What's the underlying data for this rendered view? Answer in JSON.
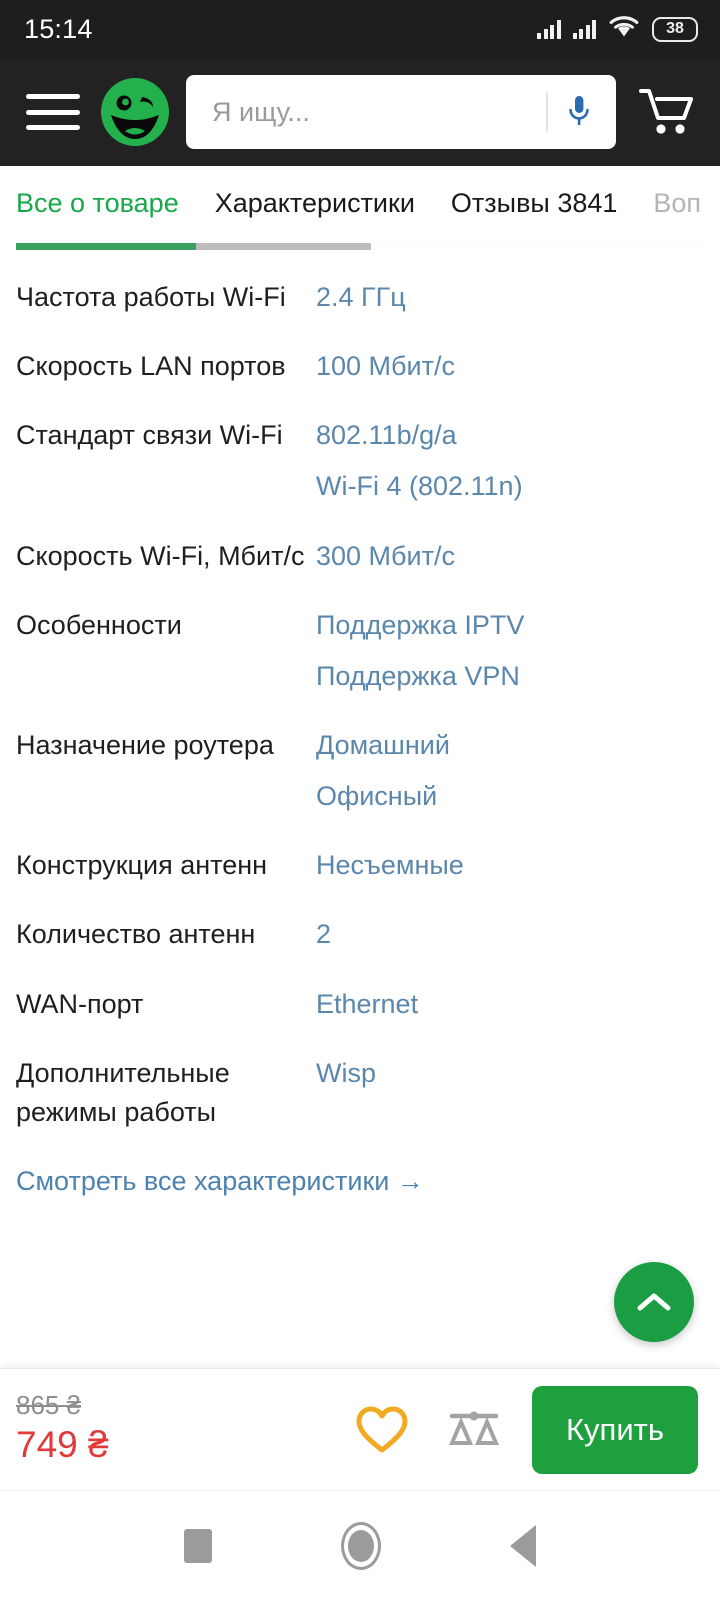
{
  "status_bar": {
    "clock": "15:14",
    "battery_level": "38",
    "icons": [
      "signal-bars-icon",
      "signal-bars-icon",
      "wifi-icon",
      "battery-icon"
    ]
  },
  "header": {
    "menu_icon": "hamburger-menu-icon",
    "logo_icon": "rozetka-smiley-logo",
    "search_placeholder": "Я ищу...",
    "search_value": "",
    "mic_icon": "microphone-icon",
    "cart_icon": "shopping-cart-icon",
    "background_color": "#222222"
  },
  "tabs": {
    "items": [
      {
        "label": "Все о товаре",
        "state": "active"
      },
      {
        "label": "Характеристики",
        "state": "normal"
      },
      {
        "label": "Отзывы 3841",
        "state": "normal"
      },
      {
        "label": "Воп",
        "state": "faded"
      }
    ],
    "active_color": "#17a84a",
    "scroll_indicator": {
      "green_width": 180,
      "gray_width": 355
    }
  },
  "specs": {
    "rows": [
      {
        "label": "Частота работы Wi-Fi",
        "values": [
          "2.4 ГГц"
        ]
      },
      {
        "label": "Скорость LAN портов",
        "values": [
          "100 Мбит/с"
        ]
      },
      {
        "label": "Стандарт связи Wi-Fi",
        "values": [
          "802.11b/g/a",
          "Wi-Fi 4 (802.11n)"
        ]
      },
      {
        "label": "Скорость Wi-Fi, Мбит/с",
        "values": [
          "300 Мбит/с"
        ]
      },
      {
        "label": "Особенности",
        "values": [
          "Поддержка IPTV",
          "Поддержка VPN"
        ]
      },
      {
        "label": "Назначение роутера",
        "values": [
          "Домашний",
          "Офисный"
        ]
      },
      {
        "label": "Конструкция антенн",
        "values": [
          "Несъемные"
        ]
      },
      {
        "label": "Количество антенн",
        "values": [
          "2"
        ]
      },
      {
        "label": "WAN-порт",
        "values": [
          "Ethernet"
        ]
      },
      {
        "label": "Дополнительные режимы работы",
        "values": [
          "Wisp"
        ]
      }
    ],
    "all_specs_link": "Смотреть все характеристики →",
    "value_color": "#5c87ad"
  },
  "scroll_to_top": {
    "icon": "chevron-up-icon",
    "color": "#1b9e43"
  },
  "buy_bar": {
    "old_price": "865 ₴",
    "new_price": "749 ₴",
    "old_price_color": "#8d8d8d",
    "new_price_color": "#e03a3a",
    "wishlist_icon": "heart-icon",
    "wishlist_color": "#f0ab22",
    "compare_icon": "scales-balance-icon",
    "compare_color": "#a3a3a3",
    "buy_label": "Купить",
    "buy_color": "#1ea03f"
  },
  "android_nav": {
    "recents_icon": "square-recents-icon",
    "home_icon": "circle-home-icon",
    "back_icon": "triangle-back-icon"
  }
}
